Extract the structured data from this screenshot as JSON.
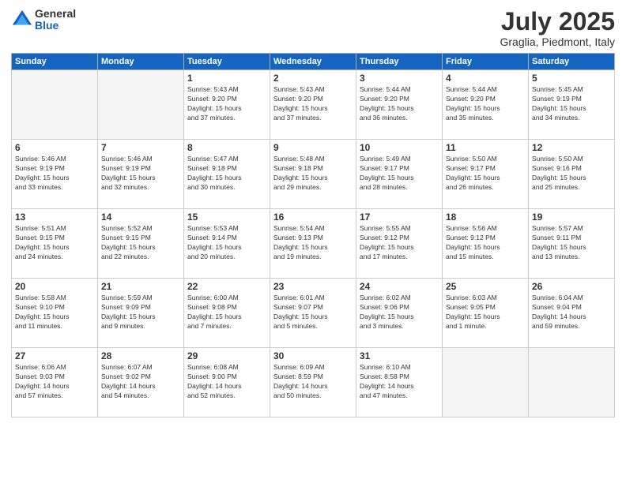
{
  "logo": {
    "general": "General",
    "blue": "Blue"
  },
  "title": "July 2025",
  "location": "Graglia, Piedmont, Italy",
  "days_header": [
    "Sunday",
    "Monday",
    "Tuesday",
    "Wednesday",
    "Thursday",
    "Friday",
    "Saturday"
  ],
  "weeks": [
    [
      {
        "day": "",
        "info": ""
      },
      {
        "day": "",
        "info": ""
      },
      {
        "day": "1",
        "info": "Sunrise: 5:43 AM\nSunset: 9:20 PM\nDaylight: 15 hours\nand 37 minutes."
      },
      {
        "day": "2",
        "info": "Sunrise: 5:43 AM\nSunset: 9:20 PM\nDaylight: 15 hours\nand 37 minutes."
      },
      {
        "day": "3",
        "info": "Sunrise: 5:44 AM\nSunset: 9:20 PM\nDaylight: 15 hours\nand 36 minutes."
      },
      {
        "day": "4",
        "info": "Sunrise: 5:44 AM\nSunset: 9:20 PM\nDaylight: 15 hours\nand 35 minutes."
      },
      {
        "day": "5",
        "info": "Sunrise: 5:45 AM\nSunset: 9:19 PM\nDaylight: 15 hours\nand 34 minutes."
      }
    ],
    [
      {
        "day": "6",
        "info": "Sunrise: 5:46 AM\nSunset: 9:19 PM\nDaylight: 15 hours\nand 33 minutes."
      },
      {
        "day": "7",
        "info": "Sunrise: 5:46 AM\nSunset: 9:19 PM\nDaylight: 15 hours\nand 32 minutes."
      },
      {
        "day": "8",
        "info": "Sunrise: 5:47 AM\nSunset: 9:18 PM\nDaylight: 15 hours\nand 30 minutes."
      },
      {
        "day": "9",
        "info": "Sunrise: 5:48 AM\nSunset: 9:18 PM\nDaylight: 15 hours\nand 29 minutes."
      },
      {
        "day": "10",
        "info": "Sunrise: 5:49 AM\nSunset: 9:17 PM\nDaylight: 15 hours\nand 28 minutes."
      },
      {
        "day": "11",
        "info": "Sunrise: 5:50 AM\nSunset: 9:17 PM\nDaylight: 15 hours\nand 26 minutes."
      },
      {
        "day": "12",
        "info": "Sunrise: 5:50 AM\nSunset: 9:16 PM\nDaylight: 15 hours\nand 25 minutes."
      }
    ],
    [
      {
        "day": "13",
        "info": "Sunrise: 5:51 AM\nSunset: 9:15 PM\nDaylight: 15 hours\nand 24 minutes."
      },
      {
        "day": "14",
        "info": "Sunrise: 5:52 AM\nSunset: 9:15 PM\nDaylight: 15 hours\nand 22 minutes."
      },
      {
        "day": "15",
        "info": "Sunrise: 5:53 AM\nSunset: 9:14 PM\nDaylight: 15 hours\nand 20 minutes."
      },
      {
        "day": "16",
        "info": "Sunrise: 5:54 AM\nSunset: 9:13 PM\nDaylight: 15 hours\nand 19 minutes."
      },
      {
        "day": "17",
        "info": "Sunrise: 5:55 AM\nSunset: 9:12 PM\nDaylight: 15 hours\nand 17 minutes."
      },
      {
        "day": "18",
        "info": "Sunrise: 5:56 AM\nSunset: 9:12 PM\nDaylight: 15 hours\nand 15 minutes."
      },
      {
        "day": "19",
        "info": "Sunrise: 5:57 AM\nSunset: 9:11 PM\nDaylight: 15 hours\nand 13 minutes."
      }
    ],
    [
      {
        "day": "20",
        "info": "Sunrise: 5:58 AM\nSunset: 9:10 PM\nDaylight: 15 hours\nand 11 minutes."
      },
      {
        "day": "21",
        "info": "Sunrise: 5:59 AM\nSunset: 9:09 PM\nDaylight: 15 hours\nand 9 minutes."
      },
      {
        "day": "22",
        "info": "Sunrise: 6:00 AM\nSunset: 9:08 PM\nDaylight: 15 hours\nand 7 minutes."
      },
      {
        "day": "23",
        "info": "Sunrise: 6:01 AM\nSunset: 9:07 PM\nDaylight: 15 hours\nand 5 minutes."
      },
      {
        "day": "24",
        "info": "Sunrise: 6:02 AM\nSunset: 9:06 PM\nDaylight: 15 hours\nand 3 minutes."
      },
      {
        "day": "25",
        "info": "Sunrise: 6:03 AM\nSunset: 9:05 PM\nDaylight: 15 hours\nand 1 minute."
      },
      {
        "day": "26",
        "info": "Sunrise: 6:04 AM\nSunset: 9:04 PM\nDaylight: 14 hours\nand 59 minutes."
      }
    ],
    [
      {
        "day": "27",
        "info": "Sunrise: 6:06 AM\nSunset: 9:03 PM\nDaylight: 14 hours\nand 57 minutes."
      },
      {
        "day": "28",
        "info": "Sunrise: 6:07 AM\nSunset: 9:02 PM\nDaylight: 14 hours\nand 54 minutes."
      },
      {
        "day": "29",
        "info": "Sunrise: 6:08 AM\nSunset: 9:00 PM\nDaylight: 14 hours\nand 52 minutes."
      },
      {
        "day": "30",
        "info": "Sunrise: 6:09 AM\nSunset: 8:59 PM\nDaylight: 14 hours\nand 50 minutes."
      },
      {
        "day": "31",
        "info": "Sunrise: 6:10 AM\nSunset: 8:58 PM\nDaylight: 14 hours\nand 47 minutes."
      },
      {
        "day": "",
        "info": ""
      },
      {
        "day": "",
        "info": ""
      }
    ]
  ]
}
